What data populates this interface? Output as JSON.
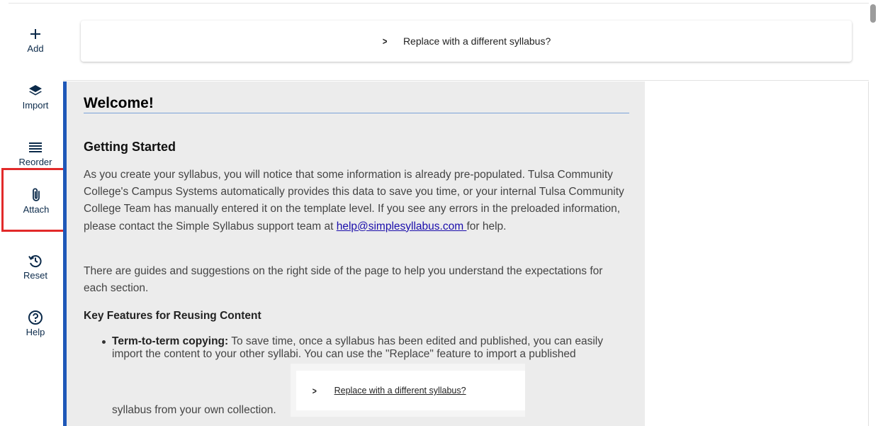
{
  "toolbar": {
    "items": [
      {
        "label": "Add"
      },
      {
        "label": "Import"
      },
      {
        "label": "Reorder"
      },
      {
        "label": "Attach"
      },
      {
        "label": "Reset"
      },
      {
        "label": "Help"
      }
    ]
  },
  "replace_bar": {
    "label": "Replace with a different syllabus?"
  },
  "content": {
    "title": "Welcome!",
    "getting_started": "Getting Started",
    "para1_text": "As you create your syllabus, you will notice that some information is already pre-populated. Tulsa Community College's Campus Systems automatically provides this data to save you time, or your internal Tulsa Community College Team has manually entered it on the template level. If you see any errors in the preloaded information, please contact the Simple Syllabus support team at ",
    "para1_link": "help@simplesyllabus.com ",
    "para1_end": "for help.",
    "para2": "There are guides and suggestions on the right side of the page to help you understand the expectations for each section.",
    "key_features": "Key Features for Reusing Content",
    "bullet_title": "Term-to-term copying:",
    "bullet_text": " To save time, once a syllabus has been edited and published, you can easily import the content to your other syllabi. You can use the \"Replace\" feature to import a published",
    "bullet_cont": "syllabus from your own collection."
  },
  "embed": {
    "label": "Replace with a different syllabus?"
  },
  "colors": {
    "accent": "#1f58b8",
    "highlight": "#e22a2a",
    "link": "#1a0dab"
  }
}
